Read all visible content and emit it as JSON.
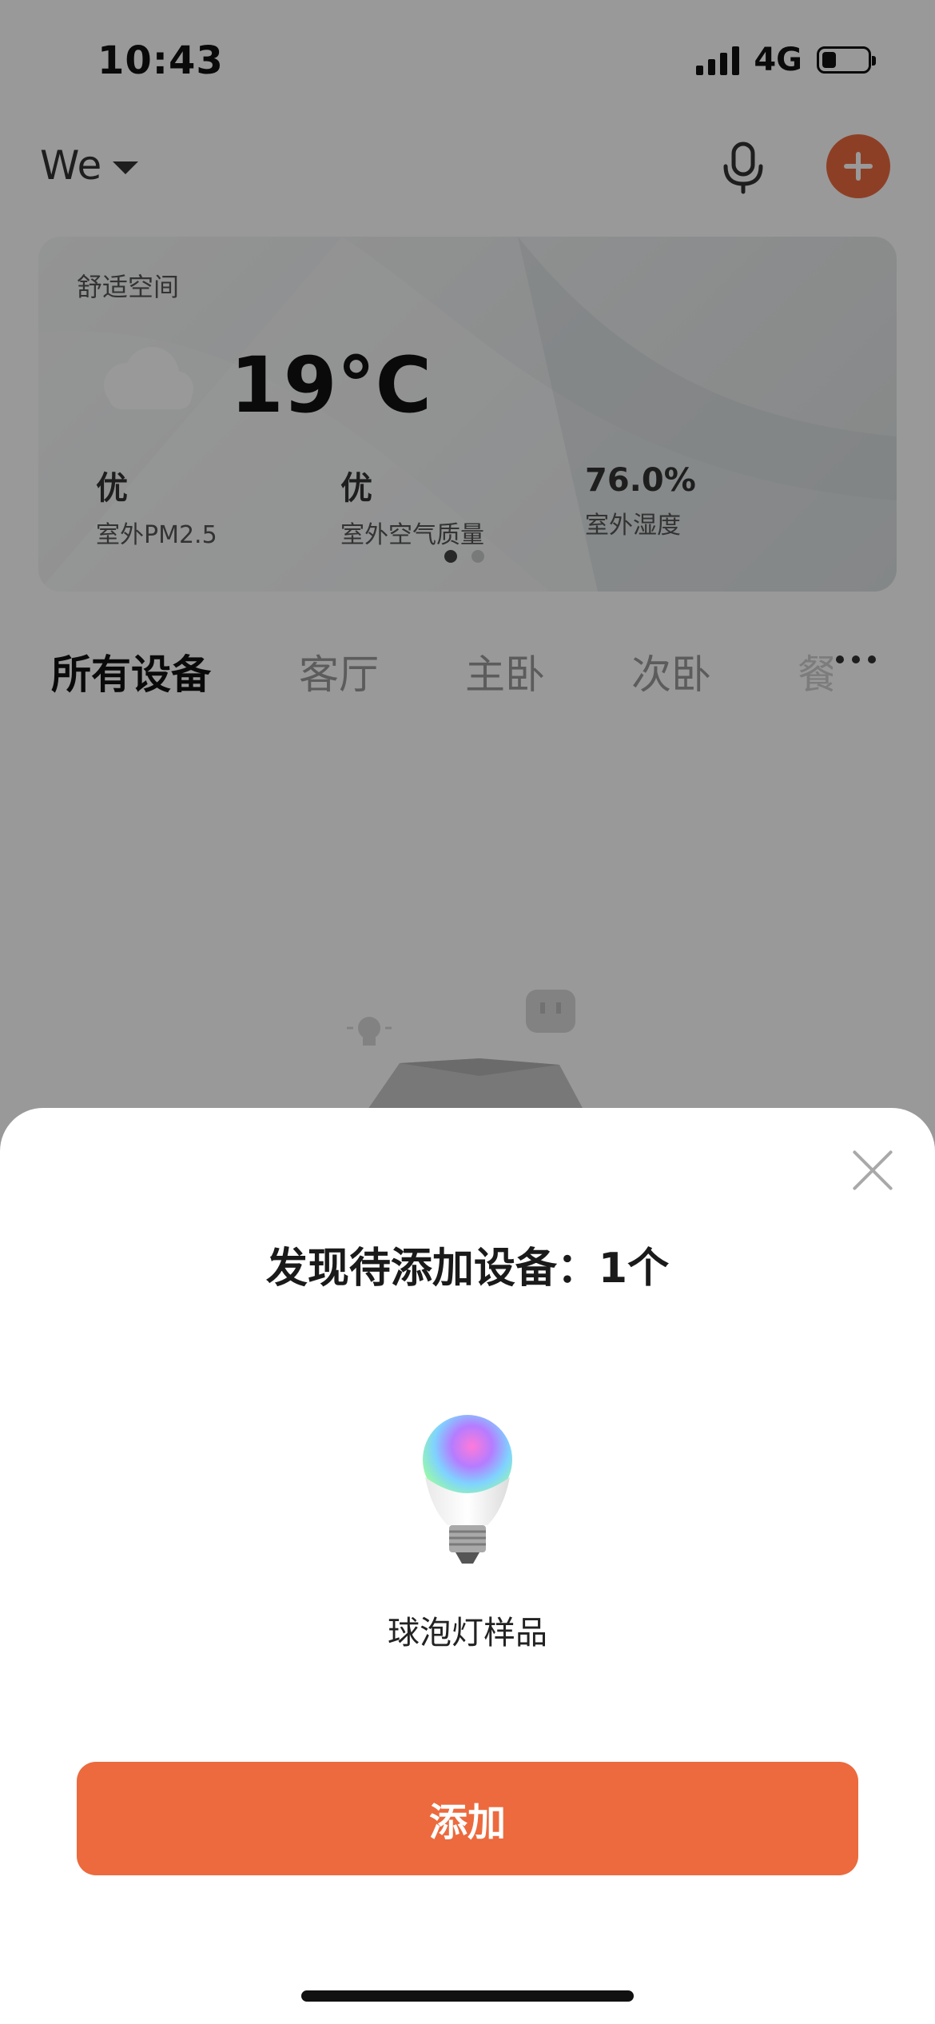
{
  "status_bar": {
    "time": "10:43",
    "network": "4G",
    "battery_level": 0.3
  },
  "header": {
    "home_name": "We",
    "icons": {
      "mic": "microphone-icon",
      "add": "plus-icon"
    },
    "accent_color": "#ec6a3e"
  },
  "weather_card": {
    "title": "舒适空间",
    "weather_icon": "cloud-icon",
    "temperature": "19°C",
    "stats": [
      {
        "value": "优",
        "label": "室外PM2.5"
      },
      {
        "value": "优",
        "label": "室外空气质量"
      },
      {
        "value": "76.0%",
        "label": "室外湿度"
      }
    ],
    "page_indicator": {
      "count": 2,
      "active": 1
    }
  },
  "rooms": {
    "tabs": [
      "所有设备",
      "客厅",
      "主卧",
      "次卧",
      "餐"
    ],
    "active": "所有设备",
    "more_icon": "more-icon"
  },
  "sheet": {
    "title": "发现待添加设备：1个",
    "device": {
      "name": "球泡灯样品",
      "image_icon": "bulb-icon"
    },
    "add_label": "添加",
    "close_icon": "close-icon",
    "button_color": "#ec6a3e"
  }
}
